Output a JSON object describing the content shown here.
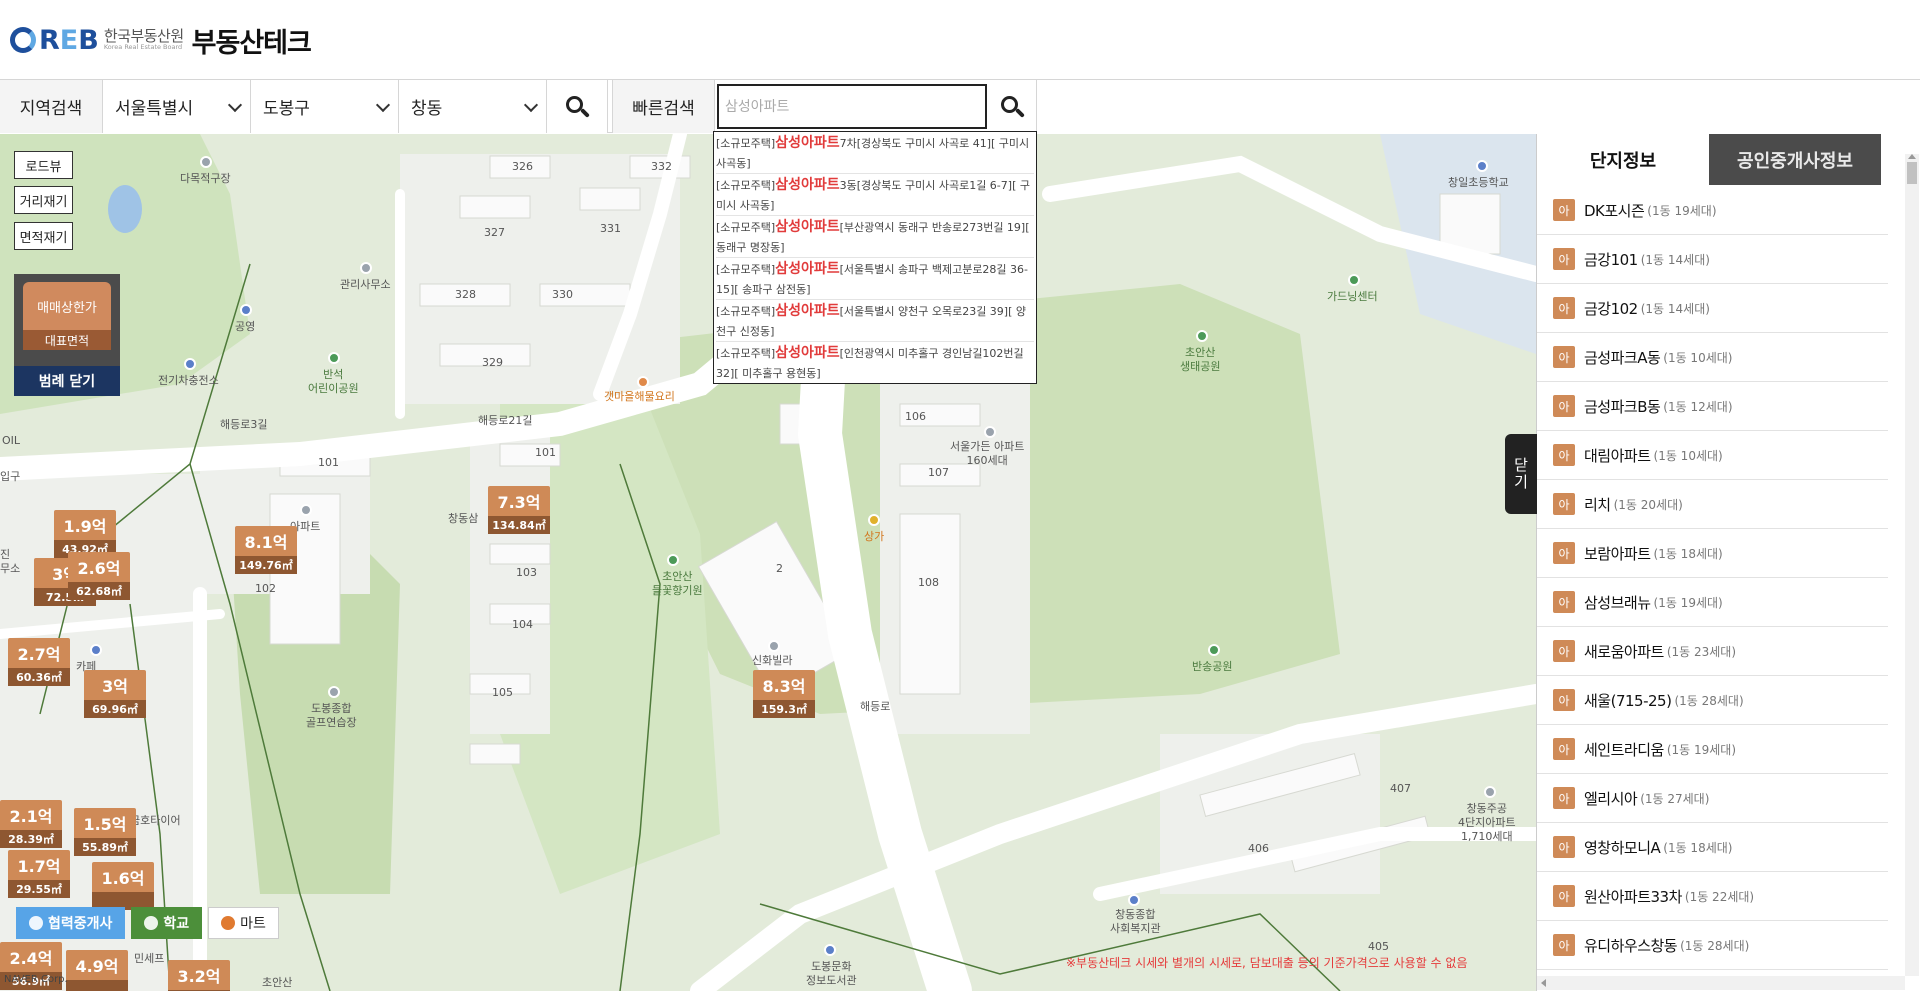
{
  "header": {
    "logo_mark": [
      "R",
      "E",
      "B"
    ],
    "org_name_kr": "한국부동산원",
    "org_name_en": "Korea Real Estate Board",
    "site_title": "부동산테크"
  },
  "search": {
    "region_label": "지역검색",
    "city": "서울특별시",
    "district": "도봉구",
    "dong": "창동",
    "quick_label": "빠른검색",
    "quick_placeholder": "삼성아파트"
  },
  "dropdown": {
    "results": [
      {
        "type": "[소규모주택]",
        "name": "삼성아파트",
        "rest": "7차[경상북도 구미시 사곡로 41][ 구미시 사곡동]"
      },
      {
        "type": "[소규모주택]",
        "name": "삼성아파트",
        "rest": "3동[경상북도 구미시 사곡로1길 6-7][ 구미시 사곡동]"
      },
      {
        "type": "[소규모주택]",
        "name": "삼성아파트",
        "rest": "[부산광역시 동래구 반송로273번길 19][ 동래구 명장동]"
      },
      {
        "type": "[소규모주택]",
        "name": "삼성아파트",
        "rest": "[서울특별시 송파구 백제고분로28길 36-15][ 송파구 삼전동]"
      },
      {
        "type": "[소규모주택]",
        "name": "삼성아파트",
        "rest": "[서울특별시 양천구 오목로23길 39][ 양천구 신정동]"
      },
      {
        "type": "[소규모주택]",
        "name": "삼성아파트",
        "rest": "[인천광역시 미추홀구 경인남길102번길 32][ 미추홀구 용현동]"
      }
    ]
  },
  "map": {
    "tools": {
      "road_view": "로드뷰",
      "distance": "거리재기",
      "area": "면적재기"
    },
    "legend": {
      "price": "매매상한가",
      "area": "대표면적",
      "close": "범례 닫기"
    },
    "markers": [
      {
        "price": "1.9억",
        "area": "43.92㎡"
      },
      {
        "price": "2.6억",
        "area": "62.68㎡"
      },
      {
        "price": "3억",
        "area": "72.5…"
      },
      {
        "price": "8.1억",
        "area": "149.76㎡"
      },
      {
        "price": "7.3억",
        "area": "134.84㎡"
      },
      {
        "price": "2.7억",
        "area": "60.36㎡"
      },
      {
        "price": "3억",
        "area": "69.96㎡"
      },
      {
        "price": "8.3억",
        "area": "159.3㎡"
      },
      {
        "price": "2.1억",
        "area": "28.39㎡"
      },
      {
        "price": "1.5억",
        "area": "55.89㎡"
      },
      {
        "price": "1.7억",
        "area": "29.55㎡"
      },
      {
        "price": "1.6억",
        "area": ""
      },
      {
        "price": "2.4억",
        "area": "56.9㎡"
      },
      {
        "price": "4.9억",
        "area": ""
      },
      {
        "price": "3.2억",
        "area": ""
      }
    ],
    "labels": {
      "daemuk": "다목적구장",
      "gwanri": "관리사무소",
      "gongyeong": "공영",
      "bansong_park": "반석\n어린이공원",
      "ev": "전기차충전소",
      "gaemaeul": "갯마을해물요리",
      "changdong": "창동삼",
      "apt_left": "아파트",
      "choansan_flower": "초안산\n들꽃향기원",
      "cafe": "카페",
      "golf": "도봉종합\n골프연습장",
      "sinhwa": "신화빌라",
      "garden": "서울가든 아파트\n160세대",
      "sangga": "상가",
      "gardening": "가드닝센터",
      "choansan_eco": "초안산\n생태공원",
      "bansong_garden": "반송공원",
      "changil": "창일초등학교",
      "changdong_jugong": "창동주공\n4단지아파트\n1,710세대",
      "welfare": "창동종합\n사회복지관",
      "library": "도봉문화\n정보도서관",
      "choansan_bottom": "초안산",
      "tire": "금호타이어",
      "oil": "OIL",
      "road_haedeung": "해등로3길",
      "road_haedeung2": "해등로21길",
      "road_n1": "해등로",
      "bld_326": "326",
      "bld_332": "332",
      "bld_327": "327",
      "bld_331": "331",
      "bld_328": "328",
      "bld_330": "330",
      "bld_329": "329",
      "bld_101a": "101",
      "bld_101b": "101",
      "bld_102": "102",
      "bld_103": "103",
      "bld_104": "104",
      "bld_105": "105",
      "bld_106": "106",
      "bld_107": "107",
      "bld_108": "108",
      "bld_2": "2",
      "bld_406": "406",
      "bld_407": "407",
      "bld_405": "405",
      "minsep": "민세프",
      "ipgu": "입구",
      "jin": "진",
      "muso": "무소"
    },
    "bottom_buttons": {
      "broker": "협력중개사",
      "school": "학교",
      "mart": "마트"
    },
    "disclaimer": "※부동산테크 시세와 별개의 시세로, 담보대출 등의 기준가격으로 사용할 수 없음",
    "naver": "NAVER Corp."
  },
  "panel": {
    "close_label": "닫기",
    "tabs": [
      "단지정보",
      "공인중개사정보"
    ],
    "tag": "아",
    "complexes": [
      {
        "name": "DK포시즌",
        "info": "(1동 19세대)"
      },
      {
        "name": "금강101",
        "info": "(1동 14세대)"
      },
      {
        "name": "금강102",
        "info": "(1동 14세대)"
      },
      {
        "name": "금성파크A동",
        "info": "(1동 10세대)"
      },
      {
        "name": "금성파크B동",
        "info": "(1동 12세대)"
      },
      {
        "name": "대림아파트",
        "info": "(1동 10세대)"
      },
      {
        "name": "리치",
        "info": "(1동 20세대)"
      },
      {
        "name": "보람아파트",
        "info": "(1동 18세대)"
      },
      {
        "name": "삼성브래뉴",
        "info": "(1동 19세대)"
      },
      {
        "name": "새로움아파트",
        "info": "(1동 23세대)"
      },
      {
        "name": "새울(715-25)",
        "info": "(1동 28세대)"
      },
      {
        "name": "세인트라디움",
        "info": "(1동 19세대)"
      },
      {
        "name": "엘리시아",
        "info": "(1동 27세대)"
      },
      {
        "name": "영창하모니A",
        "info": "(1동 18세대)"
      },
      {
        "name": "원산아파트33차",
        "info": "(1동 22세대)"
      },
      {
        "name": "유디하우스창동",
        "info": "(1동 28세대)"
      }
    ]
  },
  "colors": {
    "marker_price": "#cf8a57",
    "marker_area": "#8e5731",
    "legend_close": "#1c3561",
    "highlight": "#e13b3b",
    "park": "#cde0b8"
  }
}
